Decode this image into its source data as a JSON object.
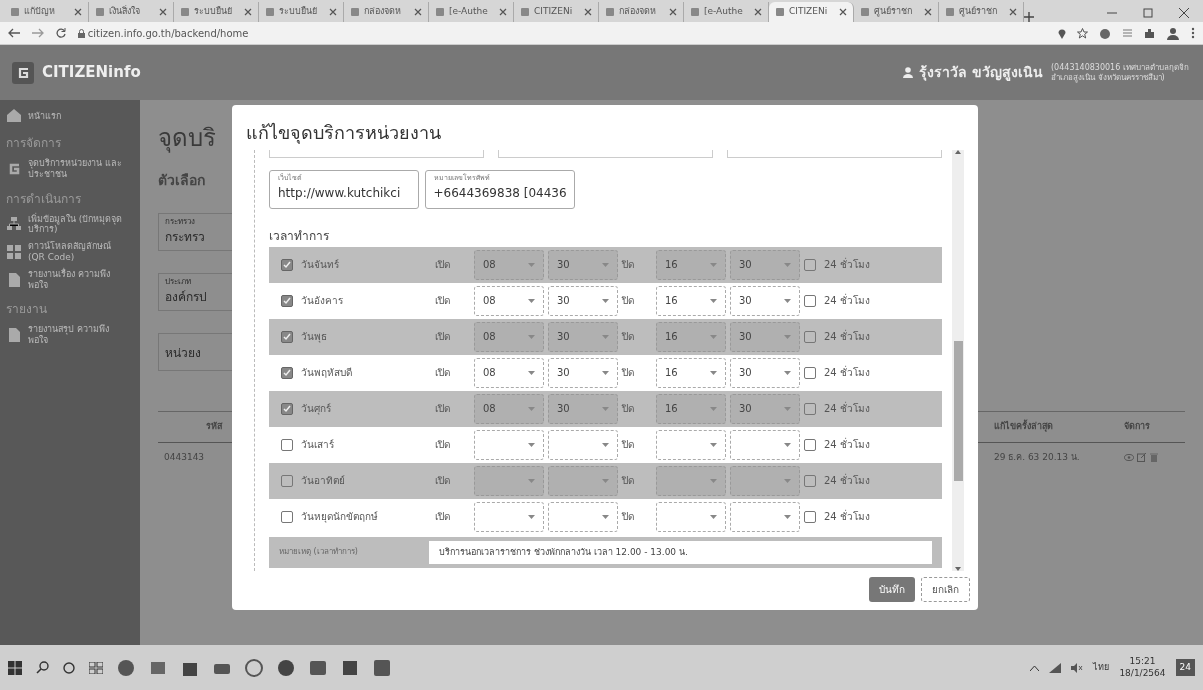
{
  "browser": {
    "tabs": [
      {
        "label": "แก้ปัญห",
        "selected": false
      },
      {
        "label": "เงินสิ่งใจ",
        "selected": false
      },
      {
        "label": "ระบบยืนยั",
        "selected": false
      },
      {
        "label": "ระบบยืนยั",
        "selected": false
      },
      {
        "label": "กล่องจดห",
        "selected": false
      },
      {
        "label": "[e-Authe",
        "selected": false
      },
      {
        "label": "CITIZENi",
        "selected": false
      },
      {
        "label": "กล่องจดห",
        "selected": false
      },
      {
        "label": "[e-Authe",
        "selected": false
      },
      {
        "label": "CITIZENi",
        "selected": true
      },
      {
        "label": "ศูนย์ราชก",
        "selected": false
      },
      {
        "label": "ศูนย์ราชก",
        "selected": false
      }
    ],
    "url": "citizen.info.go.th/backend/home"
  },
  "app": {
    "brand": "CITIZENinfo",
    "user_name": "รุ้งราวัล ขวัญสูงเนิน",
    "user_org": "(0443140830016 เทศบาลตำบลกุดจิก อำเภอสูงเนิน จังหวัดนครราชสีมา)"
  },
  "sidebar": {
    "items": [
      {
        "kind": "link",
        "label": "หน้าแรก"
      },
      {
        "kind": "heading",
        "label": "การจัดการ"
      },
      {
        "kind": "link",
        "label": "จุดบริการหน่วยงาน และประชาชน"
      },
      {
        "kind": "heading",
        "label": "การดำเนินการ"
      },
      {
        "kind": "link",
        "label": "เพิ่มข้อมูลใน (ปักหมุดจุดบริการ)"
      },
      {
        "kind": "link",
        "label": "ดาวน์โหลดสัญลักษณ์ (QR Code)"
      },
      {
        "kind": "link",
        "label": "รายงานเรื่อง ความพึงพอใจ"
      },
      {
        "kind": "heading",
        "label": "รายงาน"
      },
      {
        "kind": "link",
        "label": "รายงานสรุป ความพึงพอใจ"
      }
    ]
  },
  "page": {
    "title": "จุดบริ",
    "filter_title": "ตัวเลือก",
    "filters": [
      {
        "label": "กระทรวง",
        "value": "กระทรว"
      },
      {
        "label": "ประเภท",
        "value": "องค์กรป"
      },
      {
        "value": "หน่วยง"
      }
    ],
    "table": {
      "columns": [
        "รหัส",
        "แก้ไขครั้งล่าสุด",
        "จัดการ"
      ],
      "rows": [
        [
          "0443143",
          "29 ธ.ค. 63 20.13 น."
        ]
      ]
    }
  },
  "modal": {
    "title": "แก้ไขจุดบริการหน่วยงาน",
    "fields": [
      {
        "label": "เว็บไซต์",
        "value": "http://www.kutchikci"
      },
      {
        "label": "หมายเลขโทรศัพท์",
        "value": "+6644369838 [04436"
      }
    ],
    "hours_title": "เวลาทำการ",
    "days": [
      {
        "label": "วันจันทร์",
        "checked": true,
        "open_label": "เปิด",
        "open_hour": "08",
        "open_minute": "30",
        "close_label": "ปิด",
        "close_hour": "16",
        "close_minute": "30",
        "allday_label": "24 ชั่วโมง",
        "allday": false
      },
      {
        "label": "วันอังคาร",
        "checked": true,
        "open_label": "เปิด",
        "open_hour": "08",
        "open_minute": "30",
        "close_label": "ปิด",
        "close_hour": "16",
        "close_minute": "30",
        "allday_label": "24 ชั่วโมง",
        "allday": false
      },
      {
        "label": "วันพุธ",
        "checked": true,
        "open_label": "เปิด",
        "open_hour": "08",
        "open_minute": "30",
        "close_label": "ปิด",
        "close_hour": "16",
        "close_minute": "30",
        "allday_label": "24 ชั่วโมง",
        "allday": false
      },
      {
        "label": "วันพฤหัสบดี",
        "checked": true,
        "open_label": "เปิด",
        "open_hour": "08",
        "open_minute": "30",
        "close_label": "ปิด",
        "close_hour": "16",
        "close_minute": "30",
        "allday_label": "24 ชั่วโมง",
        "allday": false
      },
      {
        "label": "วันศุกร์",
        "checked": true,
        "open_label": "เปิด",
        "open_hour": "08",
        "open_minute": "30",
        "close_label": "ปิด",
        "close_hour": "16",
        "close_minute": "30",
        "allday_label": "24 ชั่วโมง",
        "allday": false
      },
      {
        "label": "วันเสาร์",
        "checked": false,
        "open_label": "เปิด",
        "close_label": "ปิด",
        "allday_label": "24 ชั่วโมง",
        "allday": false
      },
      {
        "label": "วันอาทิตย์",
        "checked": false,
        "open_label": "เปิด",
        "close_label": "ปิด",
        "allday_label": "24 ชั่วโมง",
        "allday": false
      },
      {
        "label": "วันหยุดนักขัตฤกษ์",
        "checked": false,
        "open_label": "เปิด",
        "close_label": "ปิด",
        "allday_label": "24 ชั่วโมง",
        "allday": false
      }
    ],
    "note": {
      "label": "หมายเหตุ (เวลาทำการ)",
      "value": "บริการนอกเวลาราชการ ช่วงพักกลางวัน เวลา 12.00 - 13.00 น."
    },
    "buttons": [
      {
        "label": "บันทึก",
        "kind": "primary"
      },
      {
        "label": "ยกเลิก",
        "kind": "secondary"
      }
    ]
  },
  "taskbar": {
    "language": "ไทย",
    "time": "15:21",
    "date": "18/1/2564",
    "notifications": "24"
  }
}
